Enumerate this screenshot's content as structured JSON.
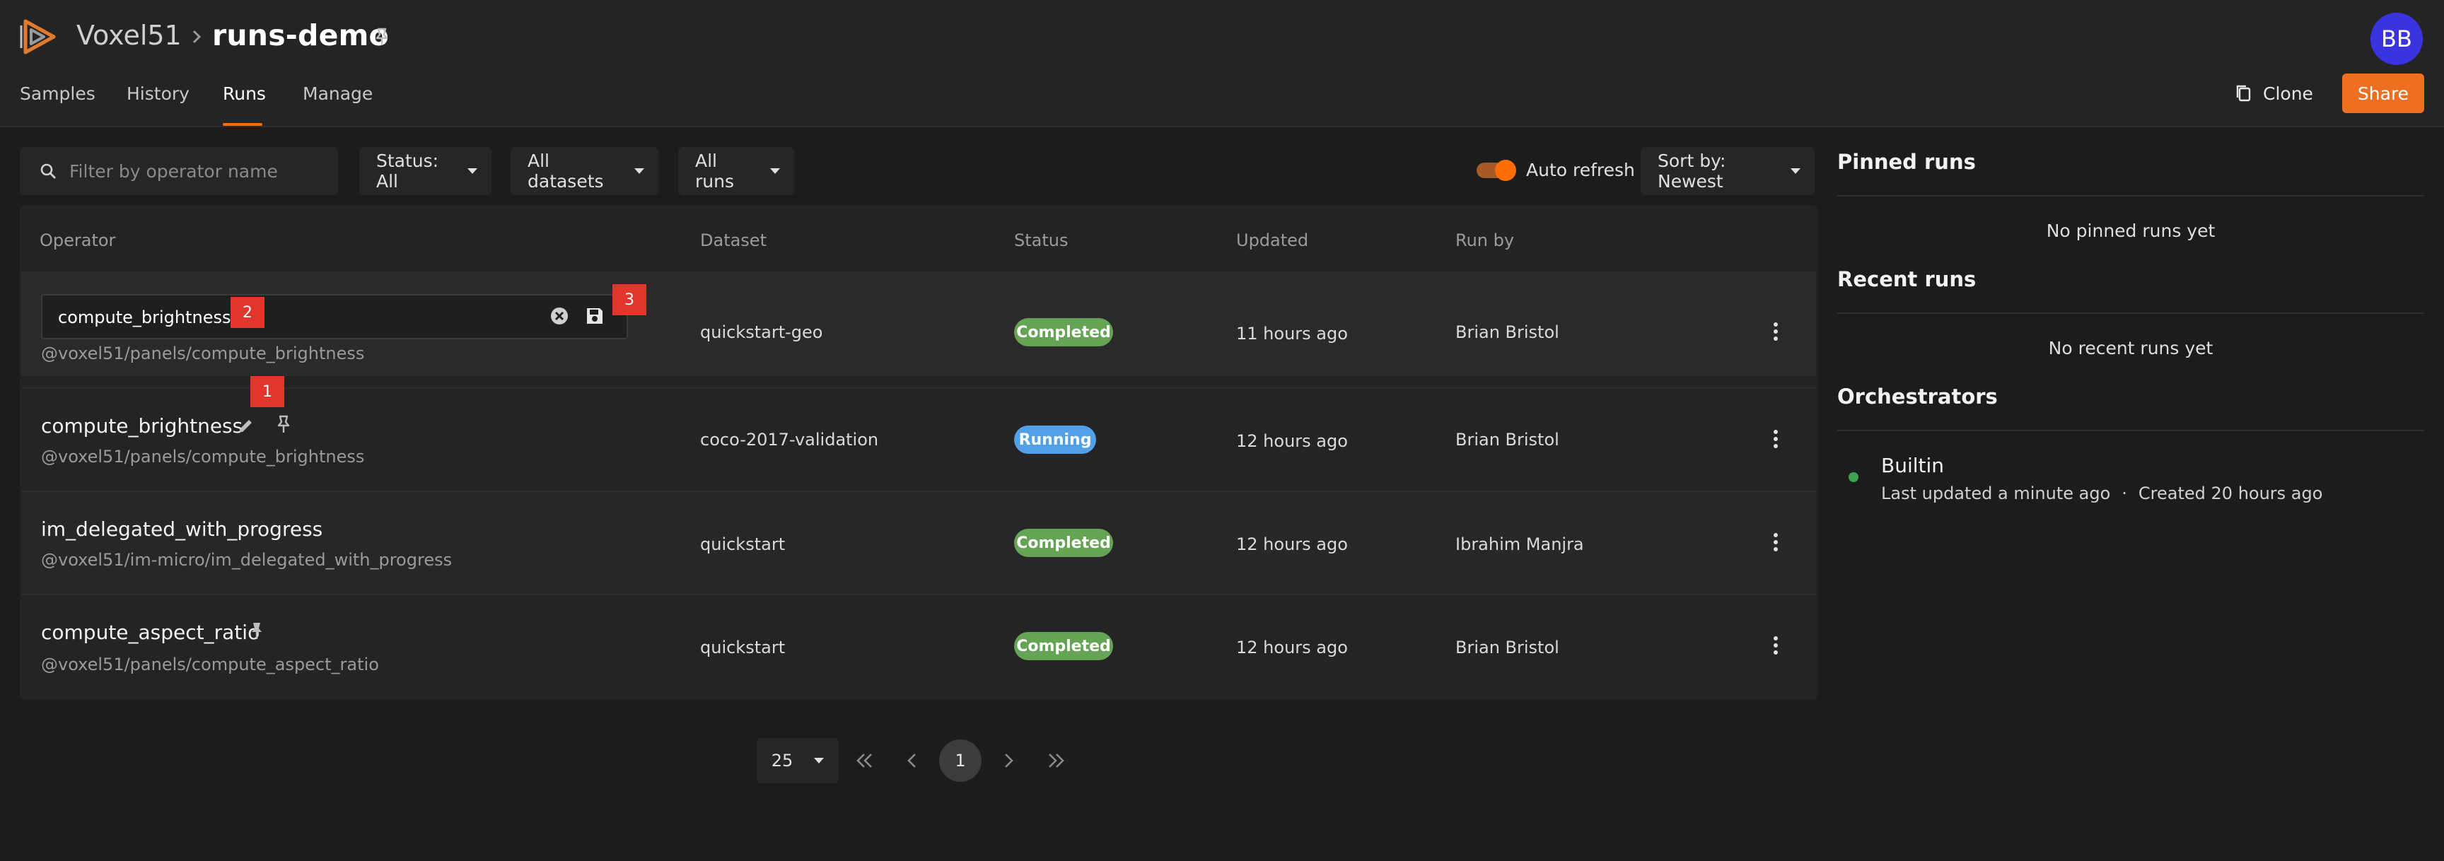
{
  "header": {
    "brand": "Voxel51",
    "dataset": "runs-demo",
    "avatar_initials": "BB",
    "tabs": [
      {
        "label": "Samples"
      },
      {
        "label": "History"
      },
      {
        "label": "Runs",
        "active": true
      },
      {
        "label": "Manage"
      }
    ],
    "clone_label": "Clone",
    "share_label": "Share"
  },
  "toolbar": {
    "search_placeholder": "Filter by operator name",
    "status_filter": "Status: All",
    "dataset_filter": "All datasets",
    "runs_filter": "All runs",
    "auto_refresh_label": "Auto refresh",
    "auto_refresh_on": true,
    "sort_label": "Sort by: Newest"
  },
  "table": {
    "columns": [
      "Operator",
      "Dataset",
      "Status",
      "Updated",
      "Run by"
    ],
    "rows": [
      {
        "operator": "compute_brightness",
        "uri": "@voxel51/panels/compute_brightness",
        "dataset": "quickstart-geo",
        "status": "Completed",
        "updated": "11 hours ago",
        "run_by": "Brian Bristol",
        "editing": true
      },
      {
        "operator": "compute_brightness",
        "uri": "@voxel51/panels/compute_brightness",
        "dataset": "coco-2017-validation",
        "status": "Running",
        "updated": "12 hours ago",
        "run_by": "Brian Bristol"
      },
      {
        "operator": "im_delegated_with_progress",
        "uri": "@voxel51/im-micro/im_delegated_with_progress",
        "dataset": "quickstart",
        "status": "Completed",
        "updated": "12 hours ago",
        "run_by": "Ibrahim Manjra"
      },
      {
        "operator": "compute_aspect_ratio",
        "uri": "@voxel51/panels/compute_aspect_ratio",
        "dataset": "quickstart",
        "status": "Completed",
        "updated": "12 hours ago",
        "run_by": "Brian Bristol",
        "pinned": true
      }
    ]
  },
  "markers": {
    "m1": "1",
    "m2": "2",
    "m3": "3"
  },
  "sidebar": {
    "pinned_title": "Pinned runs",
    "pinned_empty": "No pinned runs yet",
    "recent_title": "Recent runs",
    "recent_empty": "No recent runs yet",
    "orchestrators_title": "Orchestrators",
    "orchestrator": {
      "name": "Builtin",
      "updated": "Last updated a minute ago",
      "separator": "·",
      "created": "Created 20 hours ago"
    }
  },
  "pagination": {
    "page_size": "25",
    "current_page": "1"
  },
  "colors": {
    "accent": "#ff6d04",
    "share": "#ed6f1f",
    "completed": "#65a355",
    "running": "#52a0e8",
    "avatar": "#3b32e0",
    "marker": "#e2362c"
  },
  "icons": [
    "voxel51-logo-icon",
    "chevron-right-icon",
    "pin-icon",
    "copy-icon",
    "search-icon",
    "clear-icon",
    "save-icon",
    "edit-icon",
    "kebab-icon",
    "first-page-icon",
    "prev-page-icon",
    "next-page-icon",
    "last-page-icon"
  ]
}
